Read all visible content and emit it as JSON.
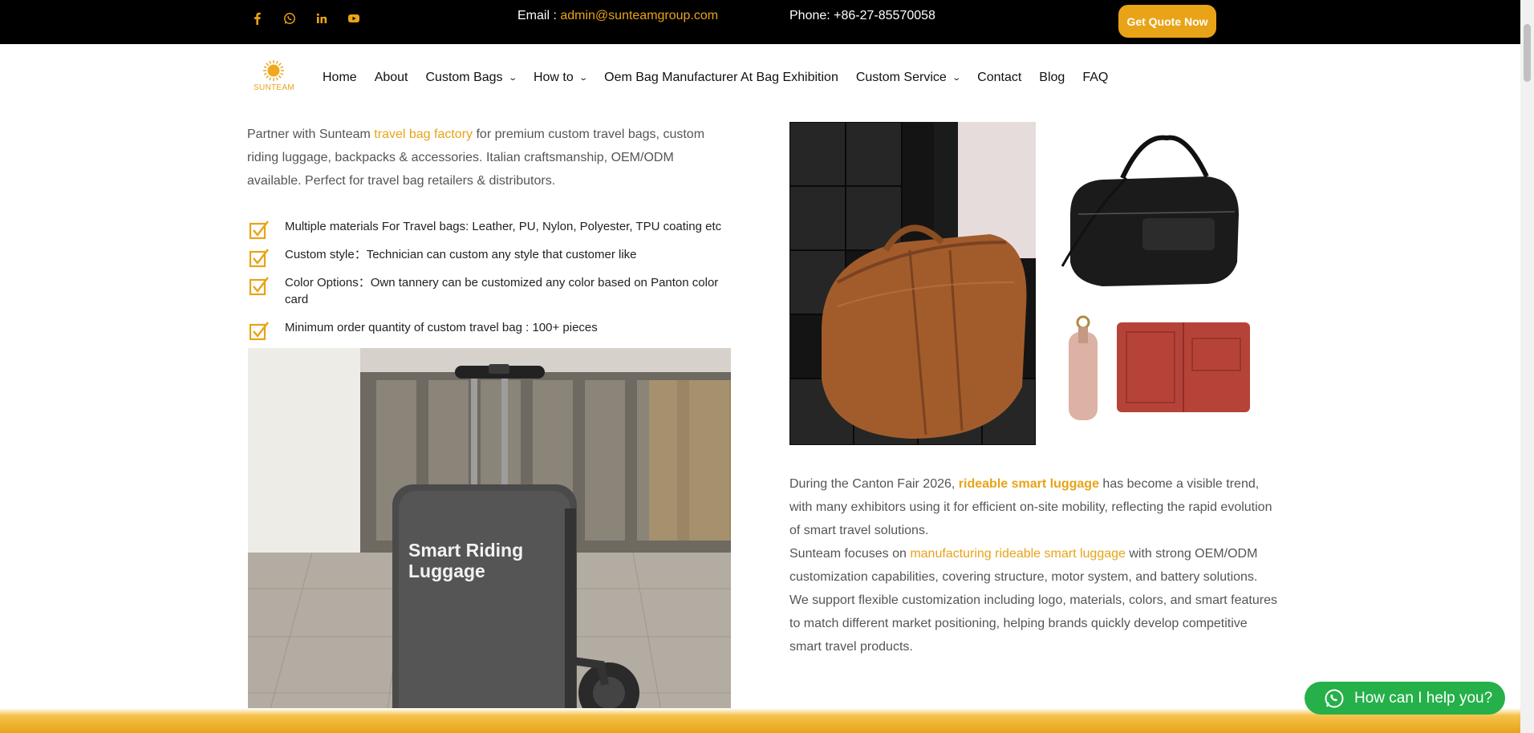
{
  "topbar": {
    "social": [
      "facebook-icon",
      "whatsapp-icon",
      "linkedin-icon",
      "youtube-icon"
    ],
    "email_label": "Email : ",
    "email": "admin@sunteamgroup.com",
    "phone": "Phone: +86-27-85570058",
    "quote_button": "Get Quote Now"
  },
  "logo": {
    "text": "SUNTEAM"
  },
  "nav": {
    "items": [
      {
        "label": "Home"
      },
      {
        "label": "About"
      },
      {
        "label": "Custom Bags",
        "dropdown": true
      },
      {
        "label": "How to",
        "dropdown": true
      },
      {
        "label": "Oem Bag Manufacturer At Bag Exhibition"
      },
      {
        "label": "Custom Service",
        "dropdown": true
      },
      {
        "label": "Contact"
      },
      {
        "label": "Blog"
      },
      {
        "label": "FAQ"
      }
    ]
  },
  "intro": {
    "prefix": " Partner with Sunteam ",
    "link": "travel bag factory",
    "suffix": " for premium custom travel bags, custom riding luggage, backpacks & accessories. Italian craftsmanship, OEM/ODM available. Perfect for travel bag retailers & distributors."
  },
  "features": [
    "Multiple materials For Travel bags: Leather, PU, Nylon, Polyester, TPU coating etc",
    "Custom style：Technician can custom any style that customer like",
    "Color Options：Own tannery can be customized any color based on Panton color card",
    "Minimum order quantity of custom travel bag : 100+ pieces"
  ],
  "luggage_image": {
    "label_line1": "Smart Riding",
    "label_line2": "Luggage"
  },
  "description": {
    "p1_prefix": "During the Canton Fair 2026, ",
    "p1_link": "rideable smart luggage",
    "p1_suffix": " has become a visible trend, with many exhibitors using it for efficient on-site mobility, reflecting the rapid evolution of smart travel solutions.",
    "p2_prefix": "Sunteam focuses on ",
    "p2_link": "manufacturing rideable smart luggage",
    "p2_suffix": " with strong OEM/ODM customization capabilities, covering structure, motor system, and battery solutions. We support flexible customization including logo, materials, colors, and smart features to match different market positioning, helping brands quickly develop competitive smart travel products."
  },
  "chat": {
    "label": "How can I help you?"
  },
  "colors": {
    "accent": "#e8a317",
    "whatsapp": "#25b04a",
    "topbar": "#000000"
  }
}
